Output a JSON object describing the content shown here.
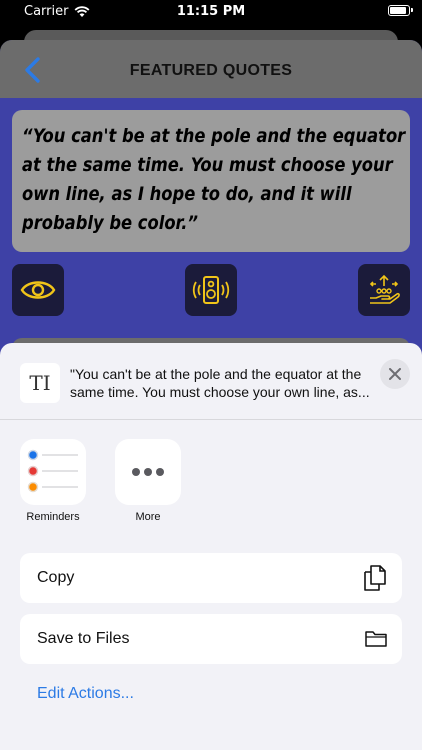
{
  "status_bar": {
    "carrier": "Carrier",
    "time": "11:15 PM"
  },
  "app": {
    "title": "FEATURED QUOTES",
    "quote": "“You can't be at the pole and the equator at the same time. You must choose your own line, as I hope to do, and it will probably be color.”",
    "colors": {
      "background": "#3e41a6",
      "button": "#1b1b3a",
      "icon": "#f0c419"
    },
    "actions": [
      {
        "icon": "eye-icon"
      },
      {
        "icon": "speaker-icon"
      },
      {
        "icon": "share-hand-icon"
      }
    ]
  },
  "share_sheet": {
    "preview_icon": "TI",
    "preview_text": "\"You can't be at the pole and the equator at the same time. You must choose your own line, as...",
    "apps": [
      {
        "label": "Reminders",
        "icon": "reminders-icon"
      },
      {
        "label": "More",
        "icon": "more-icon"
      }
    ],
    "actions": [
      {
        "label": "Copy",
        "icon": "copy-icon"
      },
      {
        "label": "Save to Files",
        "icon": "folder-icon"
      }
    ],
    "edit_actions": "Edit Actions..."
  }
}
